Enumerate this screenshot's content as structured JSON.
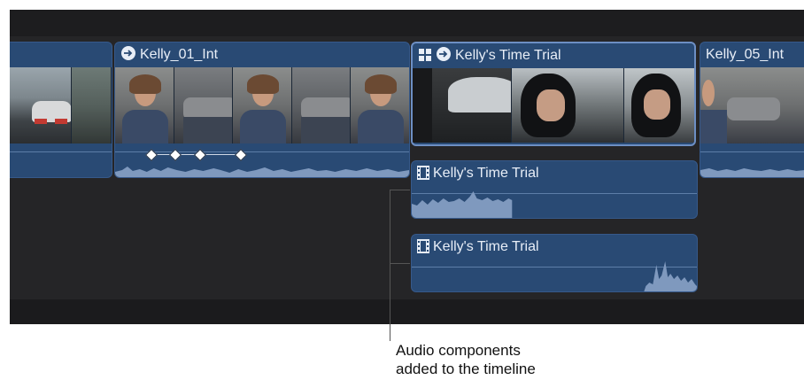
{
  "timeline": {
    "clips": {
      "left_clip": {
        "title": ""
      },
      "kelly01": {
        "title": "Kelly_01_Int",
        "icon": "connected-clip-icon"
      },
      "time_trial": {
        "title": "Kelly's Time Trial",
        "icons": [
          "multicam-icon",
          "connected-clip-icon"
        ]
      },
      "kelly05": {
        "title": "Kelly_05_Int"
      }
    },
    "audio_components": [
      {
        "title": "Kelly's Time Trial",
        "icon": "film-strip-icon"
      },
      {
        "title": "Kelly's Time Trial",
        "icon": "film-strip-icon"
      }
    ]
  },
  "callout": {
    "line1": "Audio components",
    "line2": "added to the timeline"
  }
}
